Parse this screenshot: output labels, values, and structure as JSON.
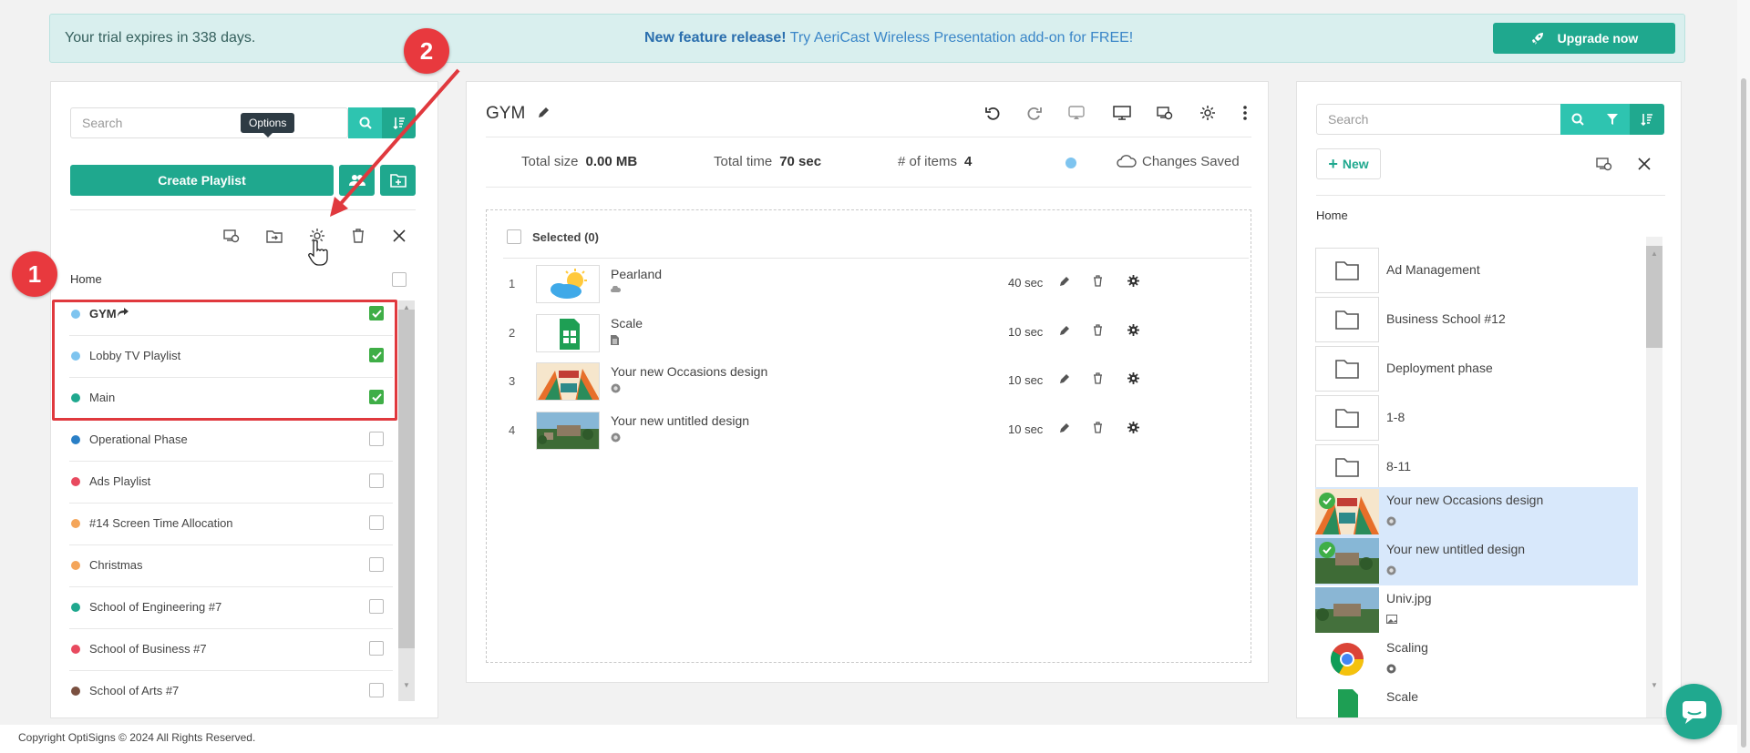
{
  "banner": {
    "trial_text": "Your trial expires in 338 days.",
    "feature_bold": "New feature release!",
    "feature_text": "Try AeriCast Wireless Presentation add-on for FREE!",
    "upgrade_label": "Upgrade now"
  },
  "left_panel": {
    "search_placeholder": "Search",
    "create_label": "Create Playlist",
    "tooltip": "Options",
    "home_label": "Home",
    "playlists": [
      {
        "name": "GYM",
        "color": "#7ec4ef",
        "checked": true
      },
      {
        "name": "Lobby TV Playlist",
        "color": "#7ec4ef",
        "checked": true
      },
      {
        "name": "Main",
        "color": "#1fa88e",
        "checked": true
      },
      {
        "name": "Operational Phase",
        "color": "#2a7fc6",
        "checked": false
      },
      {
        "name": "Ads Playlist",
        "color": "#e84a5f",
        "checked": false
      },
      {
        "name": "#14 Screen Time Allocation",
        "color": "#f4a55a",
        "checked": false
      },
      {
        "name": "Christmas",
        "color": "#f4a55a",
        "checked": false
      },
      {
        "name": "School of Engineering #7",
        "color": "#1fa88e",
        "checked": false
      },
      {
        "name": "School of Business #7",
        "color": "#e84a5f",
        "checked": false
      },
      {
        "name": "School of Arts #7",
        "color": "#7a5040",
        "checked": false
      }
    ]
  },
  "annotations": {
    "badge1": "1",
    "badge2": "2"
  },
  "center_panel": {
    "title": "GYM",
    "total_size_label": "Total size",
    "total_size_value": "0.00 MB",
    "total_time_label": "Total time",
    "total_time_value": "70 sec",
    "items_label": "# of items",
    "items_value": "4",
    "saved_label": "Changes Saved",
    "selected_label": "Selected (0)",
    "items": [
      {
        "num": "1",
        "name": "Pearland",
        "duration": "40 sec"
      },
      {
        "num": "2",
        "name": "Scale",
        "duration": "10 sec"
      },
      {
        "num": "3",
        "name": "Your new Occasions design",
        "duration": "10 sec"
      },
      {
        "num": "4",
        "name": "Your new untitled design",
        "duration": "10 sec"
      }
    ]
  },
  "right_panel": {
    "search_placeholder": "Search",
    "new_label": "New",
    "home_label": "Home",
    "folders": [
      "Ad Management",
      "Business School #12",
      "Deployment phase",
      "1-8",
      "8-11"
    ],
    "files": [
      {
        "name": "Your new Occasions design",
        "selected": true
      },
      {
        "name": "Your new untitled design",
        "selected": true
      },
      {
        "name": "Univ.jpg",
        "selected": false
      },
      {
        "name": "Scaling",
        "selected": false
      },
      {
        "name": "Scale",
        "selected": false
      }
    ]
  },
  "footer": {
    "copyright": "Copyright OptiSigns © 2024 All Rights Reserved."
  },
  "colors": {
    "accent": "#1fa88e",
    "highlight": "#e0393e",
    "selected_bg": "#d8e8fb"
  }
}
